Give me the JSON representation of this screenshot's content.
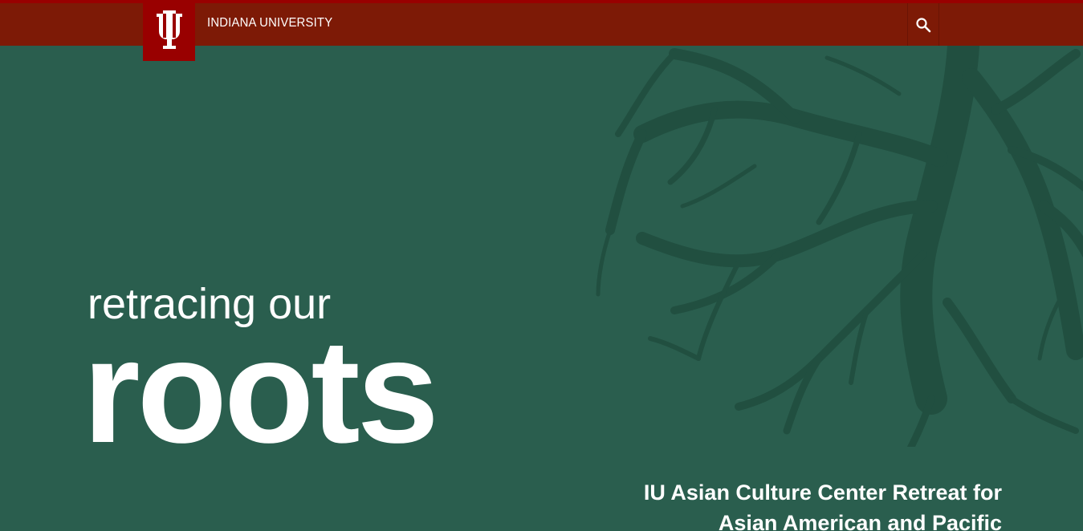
{
  "header": {
    "brand": "INDIANA UNIVERSITY",
    "logo_icon": "iu-trident-icon",
    "search_icon": "search-icon"
  },
  "hero": {
    "subtitle": "retracing our",
    "title": "roots",
    "event_title": "IU Asian Culture Center Retreat for Asian American and Pacific"
  },
  "colors": {
    "header_bg": "#7d1a06",
    "logo_bg": "#990000",
    "hero_bg": "#2a5e4e",
    "roots": "#1f4c3e",
    "text": "#ffffff"
  }
}
